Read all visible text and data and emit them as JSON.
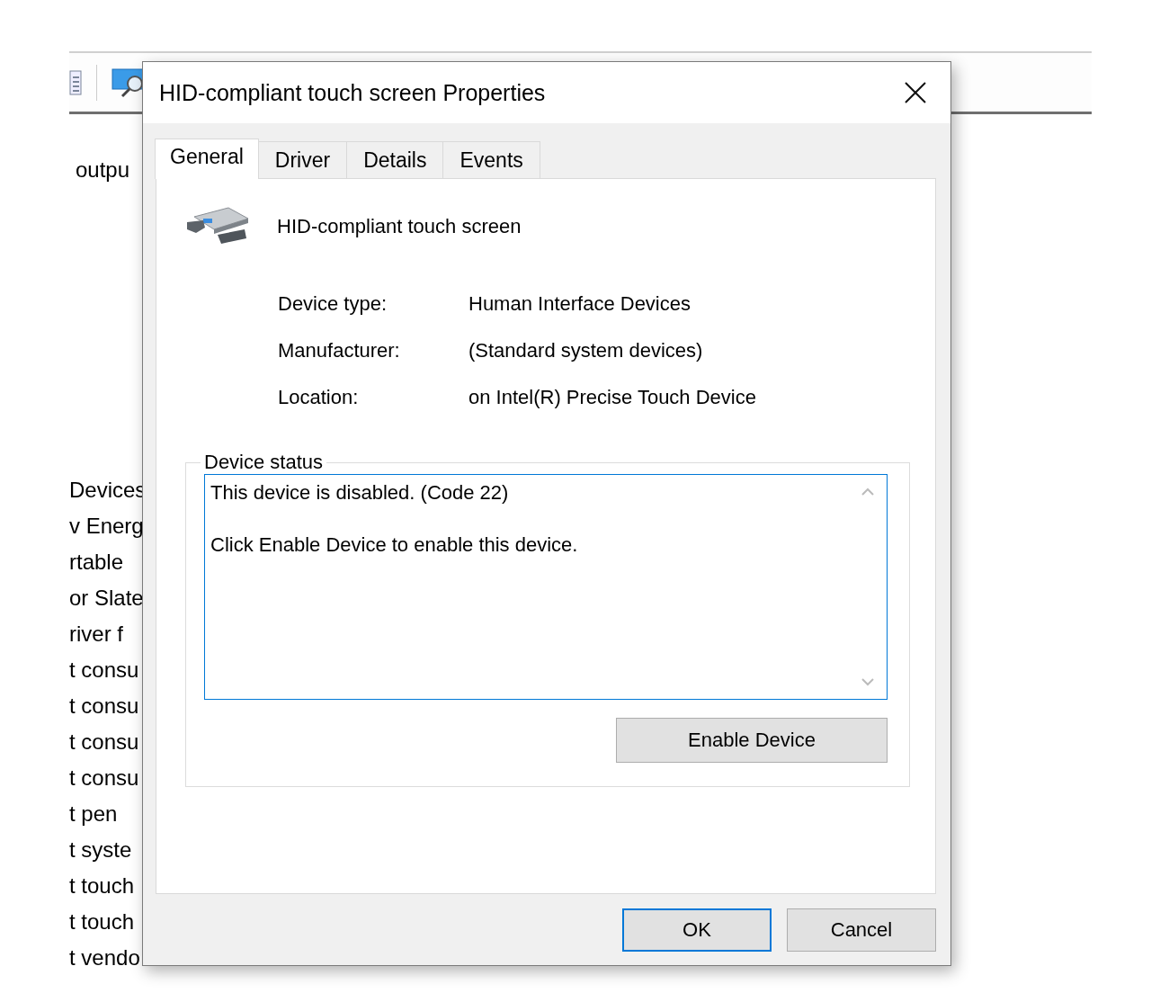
{
  "background": {
    "heading": "outpu",
    "list_items": [
      "Devices",
      "v Energ",
      "rtable",
      "or Slate",
      "river f",
      "t consu",
      "t consu",
      "t consu",
      "t consu",
      "t pen",
      "t syste",
      "t touch",
      "t touch",
      "t vendo"
    ]
  },
  "dialog": {
    "title": "HID-compliant touch screen Properties",
    "tabs": [
      {
        "label": "General",
        "selected": true
      },
      {
        "label": "Driver",
        "selected": false
      },
      {
        "label": "Details",
        "selected": false
      },
      {
        "label": "Events",
        "selected": false
      }
    ],
    "device_name": "HID-compliant touch screen",
    "properties": [
      {
        "label": "Device type:",
        "value": "Human Interface Devices"
      },
      {
        "label": "Manufacturer:",
        "value": "(Standard system devices)"
      },
      {
        "label": "Location:",
        "value": "on Intel(R) Precise Touch Device"
      }
    ],
    "status": {
      "title": "Device status",
      "lines": [
        "This device is disabled. (Code 22)",
        "Click Enable Device to enable this device."
      ],
      "button": "Enable Device"
    },
    "buttons": [
      {
        "label": "OK",
        "default": true
      },
      {
        "label": "Cancel",
        "default": false
      }
    ]
  }
}
